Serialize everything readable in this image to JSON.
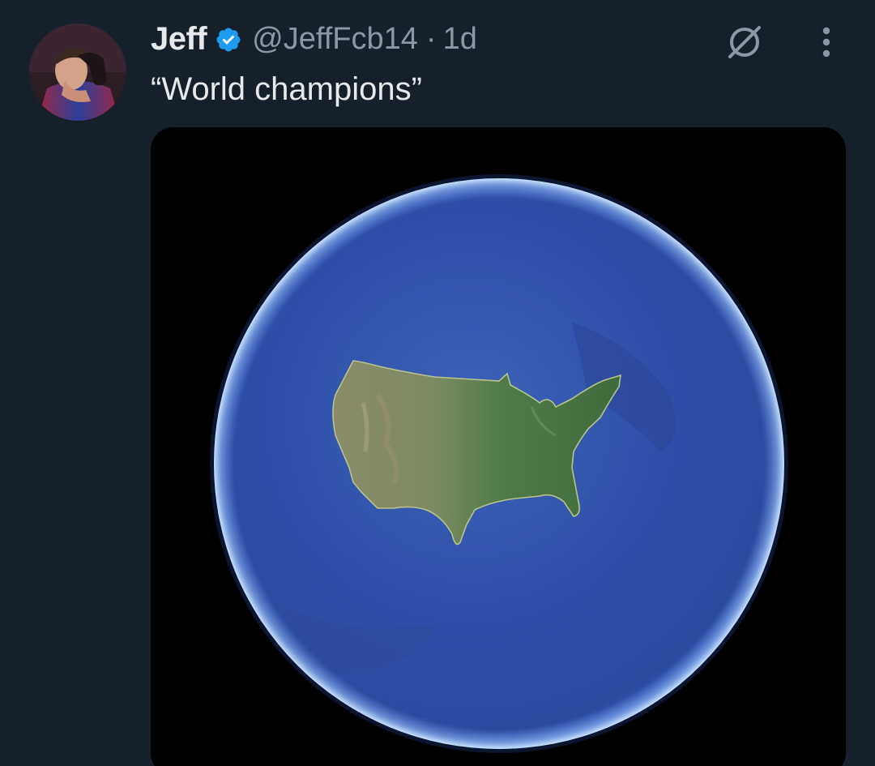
{
  "tweet": {
    "author_name": "Jeff",
    "handle": "@JeffFcb14",
    "separator": "·",
    "time": "1d",
    "text": "“World champions”"
  },
  "icons": {
    "verified": "verified-badge-icon",
    "grok": "grok-icon",
    "more": "more-vertical-icon"
  },
  "colors": {
    "background": "#15202b",
    "text_primary": "#e7e9ea",
    "text_secondary": "#8b98a5",
    "verified_blue": "#1d9bf0"
  }
}
